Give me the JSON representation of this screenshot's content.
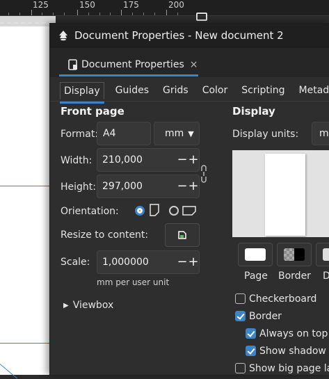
{
  "ruler": {
    "labels": [
      "125",
      "150",
      "175",
      "200"
    ]
  },
  "window": {
    "title": "Document Properties - New document 2"
  },
  "dock_tab": {
    "label": "Document Properties",
    "close": "×"
  },
  "subtabs": [
    "Display",
    "Guides",
    "Grids",
    "Color",
    "Scripting",
    "Metada"
  ],
  "front_page": {
    "title": "Front page",
    "format_label": "Format:",
    "format_value": "A4",
    "unit_value": "mm",
    "width_label": "Width:",
    "width_value": "210,000",
    "height_label": "Height:",
    "height_value": "297,000",
    "orientation_label": "Orientation:",
    "resize_label": "Resize to content:",
    "scale_label": "Scale:",
    "scale_value": "1,000000",
    "scale_hint": "mm per user unit",
    "viewbox_label": "Viewbox",
    "plus": "+",
    "minus": "−"
  },
  "display": {
    "title": "Display",
    "units_label": "Display units:",
    "units_value": "m",
    "swatches": [
      "Page",
      "Border",
      "D"
    ],
    "checkboxes": [
      {
        "label": "Checkerboard",
        "checked": false
      },
      {
        "label": "Border",
        "checked": true
      },
      {
        "label": "Always on top",
        "checked": true
      },
      {
        "label": "Show shadow",
        "checked": true
      },
      {
        "label": "Show big page la",
        "checked": false
      }
    ]
  },
  "colors": {
    "accent": "#3d84c8",
    "dialog_bg": "#2e2e2e",
    "titlebar_bg": "#1f1f1f"
  }
}
